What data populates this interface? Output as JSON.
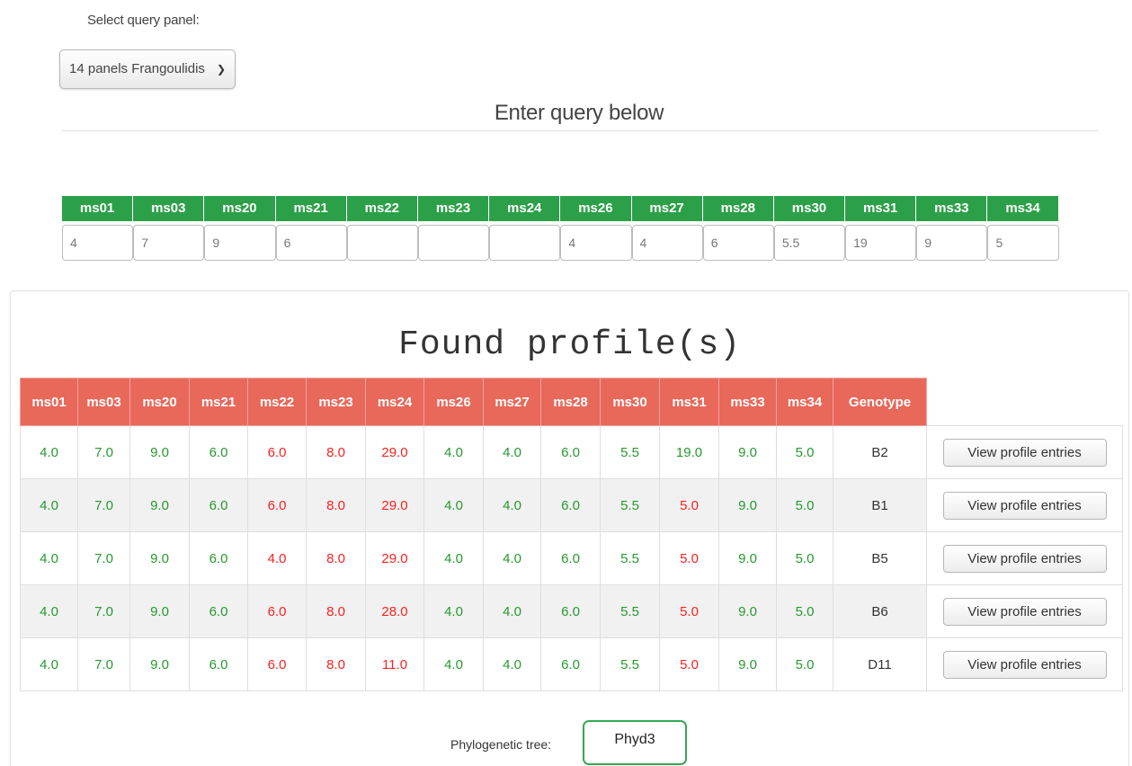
{
  "query": {
    "select_label": "Select query panel:",
    "selected_panel": "14 panels Frangoulidis",
    "enter_title": "Enter query below",
    "markers": [
      "ms01",
      "ms03",
      "ms20",
      "ms21",
      "ms22",
      "ms23",
      "ms24",
      "ms26",
      "ms27",
      "ms28",
      "ms30",
      "ms31",
      "ms33",
      "ms34"
    ],
    "values": [
      "4",
      "7",
      "9",
      "6",
      "",
      "",
      "",
      "4",
      "4",
      "6",
      "5.5",
      "19",
      "9",
      "5"
    ]
  },
  "results": {
    "title": "Found profile(s)",
    "columns": [
      "ms01",
      "ms03",
      "ms20",
      "ms21",
      "ms22",
      "ms23",
      "ms24",
      "ms26",
      "ms27",
      "ms28",
      "ms30",
      "ms31",
      "ms33",
      "ms34",
      "Genotype"
    ],
    "button_label": "View profile entries",
    "rows": [
      {
        "cells": [
          "4.0",
          "7.0",
          "9.0",
          "6.0",
          "6.0",
          "8.0",
          "29.0",
          "4.0",
          "4.0",
          "6.0",
          "5.5",
          "19.0",
          "9.0",
          "5.0",
          "B2"
        ],
        "match": [
          "g",
          "g",
          "g",
          "g",
          "r",
          "r",
          "r",
          "g",
          "g",
          "g",
          "g",
          "g",
          "g",
          "g",
          "n"
        ]
      },
      {
        "cells": [
          "4.0",
          "7.0",
          "9.0",
          "6.0",
          "6.0",
          "8.0",
          "29.0",
          "4.0",
          "4.0",
          "6.0",
          "5.5",
          "5.0",
          "9.0",
          "5.0",
          "B1"
        ],
        "match": [
          "g",
          "g",
          "g",
          "g",
          "r",
          "r",
          "r",
          "g",
          "g",
          "g",
          "g",
          "r",
          "g",
          "g",
          "n"
        ]
      },
      {
        "cells": [
          "4.0",
          "7.0",
          "9.0",
          "6.0",
          "4.0",
          "8.0",
          "29.0",
          "4.0",
          "4.0",
          "6.0",
          "5.5",
          "5.0",
          "9.0",
          "5.0",
          "B5"
        ],
        "match": [
          "g",
          "g",
          "g",
          "g",
          "r",
          "r",
          "r",
          "g",
          "g",
          "g",
          "g",
          "r",
          "g",
          "g",
          "n"
        ]
      },
      {
        "cells": [
          "4.0",
          "7.0",
          "9.0",
          "6.0",
          "6.0",
          "8.0",
          "28.0",
          "4.0",
          "4.0",
          "6.0",
          "5.5",
          "5.0",
          "9.0",
          "5.0",
          "B6"
        ],
        "match": [
          "g",
          "g",
          "g",
          "g",
          "r",
          "r",
          "r",
          "g",
          "g",
          "g",
          "g",
          "r",
          "g",
          "g",
          "n"
        ]
      },
      {
        "cells": [
          "4.0",
          "7.0",
          "9.0",
          "6.0",
          "6.0",
          "8.0",
          "11.0",
          "4.0",
          "4.0",
          "6.0",
          "5.5",
          "5.0",
          "9.0",
          "5.0",
          "D11"
        ],
        "match": [
          "g",
          "g",
          "g",
          "g",
          "r",
          "r",
          "r",
          "g",
          "g",
          "g",
          "g",
          "r",
          "g",
          "g",
          "n"
        ]
      }
    ]
  },
  "phylo": {
    "label": "Phylogenetic tree:",
    "button": "Phyd3"
  },
  "colors": {
    "query_header": "#2ca048",
    "result_header": "#e8685a",
    "match": "#259a2f",
    "mismatch": "#ff1e1e"
  }
}
